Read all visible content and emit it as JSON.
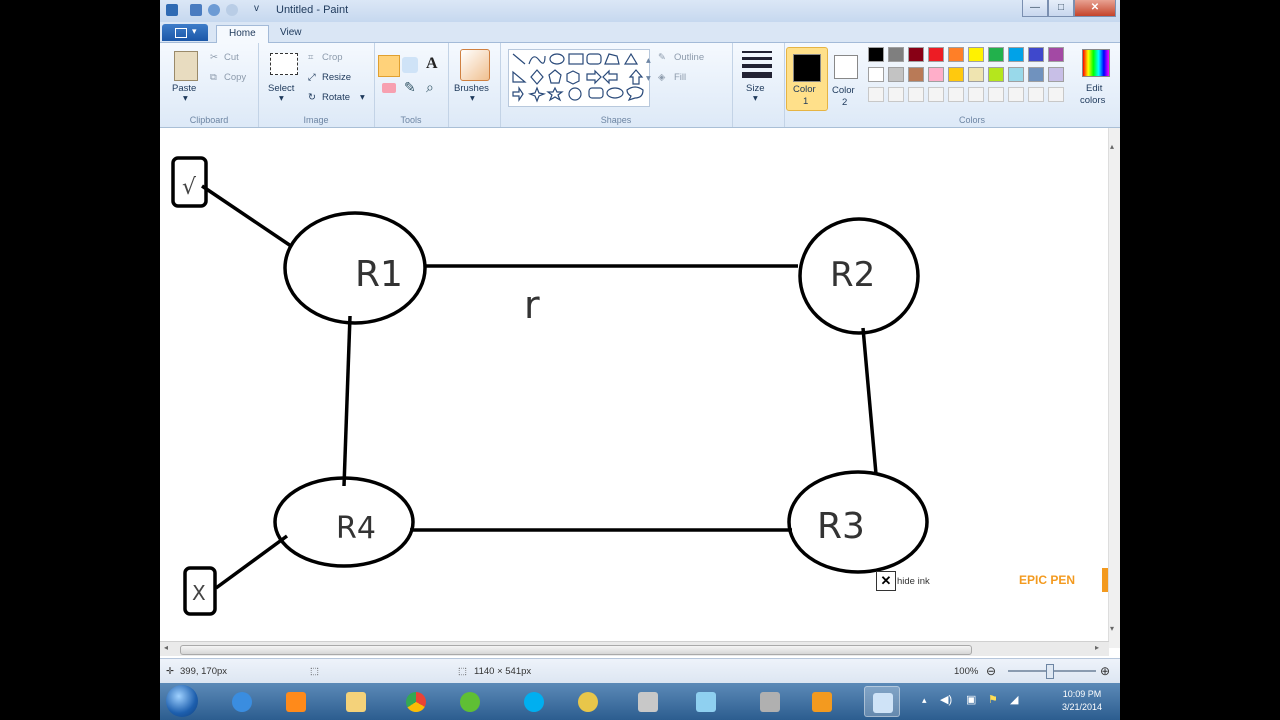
{
  "window": {
    "title": "Untitled - Paint",
    "qat_dropdown": "v",
    "controls": {
      "minimize": "—",
      "maximize": "□",
      "close": "✕"
    }
  },
  "tabs": [
    "Home",
    "View"
  ],
  "ribbon": {
    "clipboard": {
      "paste": "Paste",
      "cut": "Cut",
      "copy": "Copy",
      "group": "Clipboard"
    },
    "image": {
      "select": "Select",
      "crop": "Crop",
      "resize": "Resize",
      "rotate": "Rotate",
      "group": "Image"
    },
    "tools": {
      "group": "Tools"
    },
    "brushes": {
      "label": "Brushes"
    },
    "shapes": {
      "outline": "Outline",
      "fill": "Fill",
      "group": "Shapes"
    },
    "size": {
      "label": "Size"
    },
    "color1": {
      "label": "Color",
      "num": "1",
      "color": "#000000"
    },
    "color2": {
      "label": "Color",
      "num": "2",
      "color": "#ffffff"
    },
    "colors": {
      "group": "Colors",
      "edit_label": "Edit",
      "edit_label2": "colors",
      "row1": [
        "#000000",
        "#7f7f7f",
        "#880015",
        "#ed1c24",
        "#ff7f27",
        "#fff200",
        "#22b14c",
        "#00a2e8",
        "#3f48cc",
        "#a349a4"
      ],
      "row2": [
        "#ffffff",
        "#c3c3c3",
        "#b97a57",
        "#ffaec9",
        "#ffc90e",
        "#efe4b0",
        "#b5e61d",
        "#99d9ea",
        "#7092be",
        "#c8bfe7"
      ]
    }
  },
  "drawing": {
    "nodes": [
      {
        "label": "R1"
      },
      {
        "label": "R2"
      },
      {
        "label": "R3"
      },
      {
        "label": "R4"
      }
    ],
    "scribble": "r",
    "hide_ink": "hide ink",
    "epic_pen": "EPIC PEN"
  },
  "status": {
    "cursor": "399, 170px",
    "size": "1140 × 541px",
    "zoom": "100%"
  },
  "taskbar": {
    "time": "10:09 PM",
    "date": "3/21/2014"
  }
}
